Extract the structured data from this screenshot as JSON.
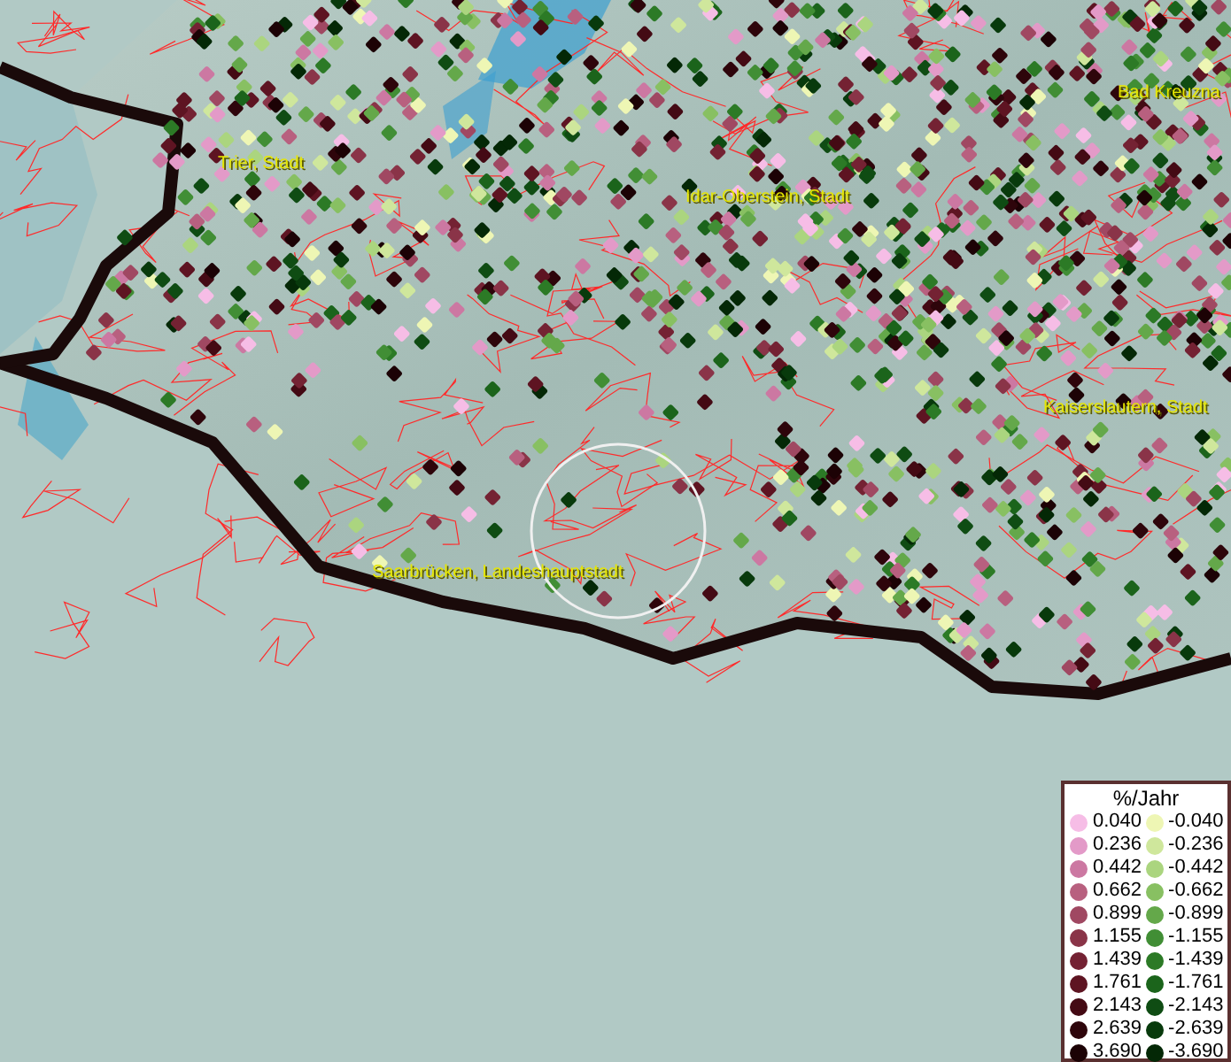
{
  "map": {
    "cities": [
      {
        "name": "Trier, Stadt"
      },
      {
        "name": "Idar-Oberstein, Stadt"
      },
      {
        "name": "Bad Kreuzna"
      },
      {
        "name": "Kaiserslautern, Stadt"
      },
      {
        "name": "Saarbrücken, Landeshauptstadt"
      }
    ]
  },
  "legend": {
    "title": "%/Jahr",
    "columns": [
      [
        {
          "label": "0.040",
          "color": "#f6bde6"
        },
        {
          "label": "0.236",
          "color": "#e39ac8"
        },
        {
          "label": "0.442",
          "color": "#cc78a2"
        },
        {
          "label": "0.662",
          "color": "#b8607f"
        },
        {
          "label": "0.899",
          "color": "#a04862"
        },
        {
          "label": "1.155",
          "color": "#8a3448"
        },
        {
          "label": "1.439",
          "color": "#742233"
        },
        {
          "label": "1.761",
          "color": "#5e1422"
        },
        {
          "label": "2.143",
          "color": "#440a14"
        },
        {
          "label": "2.639",
          "color": "#2e050b"
        },
        {
          "label": "3.690",
          "color": "#1c0205"
        }
      ],
      [
        {
          "label": "-0.040",
          "color": "#eef6b4"
        },
        {
          "label": "-0.236",
          "color": "#cfe79c"
        },
        {
          "label": "-0.442",
          "color": "#abd57f"
        },
        {
          "label": "-0.662",
          "color": "#88c062"
        },
        {
          "label": "-0.899",
          "color": "#64a84a"
        },
        {
          "label": "-1.155",
          "color": "#418e35"
        },
        {
          "label": "-1.439",
          "color": "#2c7a26"
        },
        {
          "label": "-1.761",
          "color": "#1b641b"
        },
        {
          "label": "-2.143",
          "color": "#0f4c13"
        },
        {
          "label": "-2.639",
          "color": "#083a0c"
        },
        {
          "label": "-3.690",
          "color": "#042806"
        }
      ]
    ]
  }
}
